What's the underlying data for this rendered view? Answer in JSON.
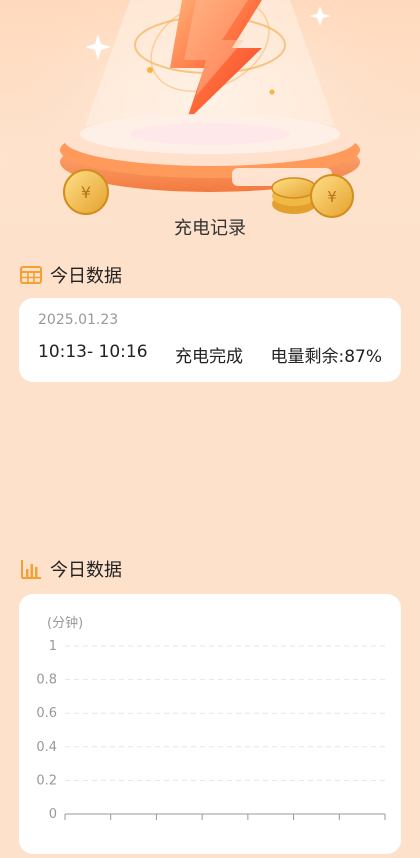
{
  "hero": {
    "title": "充电记录"
  },
  "today_section": {
    "title": "今日数据",
    "record": {
      "date": "2025.01.23",
      "time_range": "10:13- 10:16",
      "status": "充电完成",
      "remaining": "电量剩余:87%"
    }
  },
  "chart_section": {
    "title": "今日数据",
    "unit": "(分钟)"
  },
  "colors": {
    "accent": "#f5a030",
    "background": "#fde1cb",
    "card": "#ffffff"
  },
  "icons": {
    "table": "table-icon",
    "bar_chart": "bar-chart-icon"
  },
  "chart_data": {
    "type": "bar",
    "ylabel": "(分钟)",
    "ylim": [
      0,
      1
    ],
    "yticks": [
      "1",
      "0.8",
      "0.6",
      "0.4",
      "0.2",
      "0"
    ],
    "categories": [],
    "values": [],
    "grid": true
  }
}
